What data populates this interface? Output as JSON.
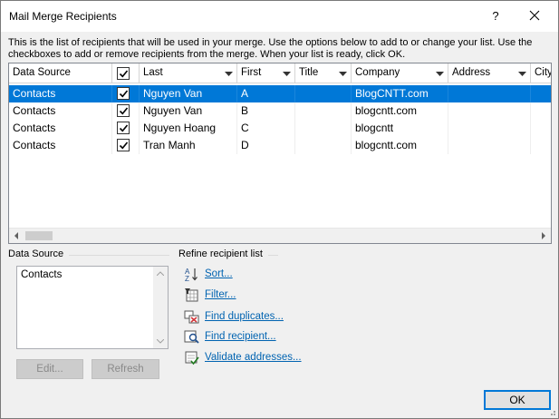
{
  "window": {
    "title": "Mail Merge Recipients",
    "help_label": "?",
    "intro": "This is the list of recipients that will be used in your merge.  Use the options below to add to or change your list. Use the checkboxes to add or remove recipients from the merge.  When your list is ready, click OK."
  },
  "grid": {
    "columns": {
      "data_source": "Data Source",
      "last": "Last",
      "first": "First",
      "title": "Title",
      "company": "Company",
      "address": "Address",
      "city": "City"
    },
    "rows": [
      {
        "source": "Contacts",
        "checked": true,
        "last": "Nguyen Van",
        "first": "A",
        "title": "",
        "company": "BlogCNTT.com",
        "address": "",
        "city": ""
      },
      {
        "source": "Contacts",
        "checked": true,
        "last": "Nguyen Van",
        "first": "B",
        "title": "",
        "company": "blogcntt.com",
        "address": "",
        "city": ""
      },
      {
        "source": "Contacts",
        "checked": true,
        "last": "Nguyen Hoang",
        "first": "C",
        "title": "",
        "company": "blogcntt",
        "address": "",
        "city": ""
      },
      {
        "source": "Contacts",
        "checked": true,
        "last": "Tran Manh",
        "first": "D",
        "title": "",
        "company": "blogcntt.com",
        "address": "",
        "city": ""
      }
    ],
    "selected_row": 0
  },
  "data_source_panel": {
    "label": "Data Source",
    "items": [
      "Contacts"
    ],
    "edit_label": "Edit...",
    "refresh_label": "Refresh"
  },
  "refine": {
    "label": "Refine recipient list",
    "items": [
      {
        "label": "Sort...",
        "icon": "sort-az-icon"
      },
      {
        "label": "Filter...",
        "icon": "filter-table-icon"
      },
      {
        "label": "Find duplicates...",
        "icon": "find-duplicates-icon"
      },
      {
        "label": "Find recipient...",
        "icon": "find-recipient-icon"
      },
      {
        "label": "Validate addresses...",
        "icon": "validate-addresses-icon"
      }
    ]
  },
  "ok_label": "OK",
  "colors": {
    "selection": "#0078d7",
    "link": "#0063b1",
    "dialog_bg": "#f0f0f0"
  }
}
